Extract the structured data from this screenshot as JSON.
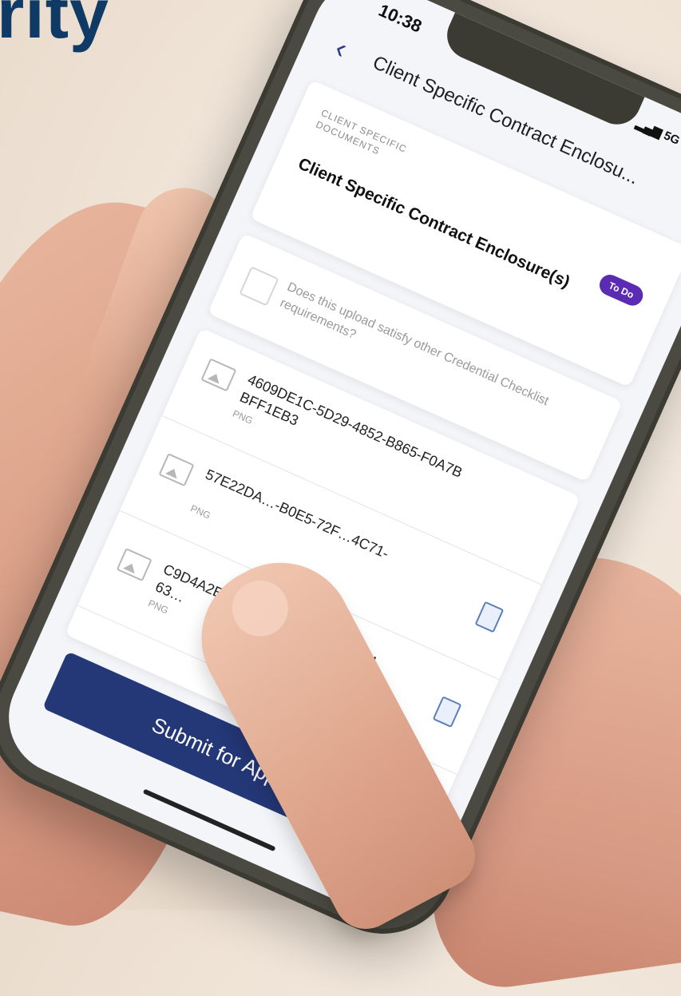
{
  "headline": "rity",
  "status": {
    "time": "10:38",
    "network": "5G"
  },
  "nav": {
    "back": "‹",
    "title": "Client Specific Contract Enclosu..."
  },
  "document": {
    "category": "CLIENT SPECIFIC DOCUMENTS",
    "title": "Client Specific Contract Enclosure(s)",
    "status_badge": "To Do"
  },
  "credential_check": {
    "label": "Does this upload satisfy other Credential Checklist requirements?"
  },
  "files": [
    {
      "name": "4609DE1C-5D29-4852-B865-F0A7BBFF1EB3",
      "type": "PNG"
    },
    {
      "name": "57E22DA…-B0E5-72F…4C71-",
      "type": "PNG"
    },
    {
      "name": "C9D4A2EC-19F4…-BD46-5AD940463…",
      "type": "PNG"
    }
  ],
  "submit_label": "Submit for Approval",
  "colors": {
    "headline": "#0f3a66",
    "submit": "#243777",
    "badge": "#5b2bb3"
  }
}
